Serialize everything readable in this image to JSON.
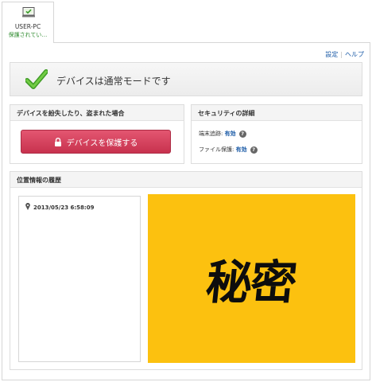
{
  "device": {
    "name": "USER-PC",
    "status": "保護されてい…",
    "icon": "computer-check-icon"
  },
  "toplinks": {
    "settings": "設定",
    "help": "ヘルプ"
  },
  "status": {
    "message": "デバイスは通常モードです",
    "icon": "green-check-icon"
  },
  "lost_card": {
    "title": "デバイスを紛失したり、盗まれた場合",
    "button_label": "デバイスを保護する"
  },
  "security_card": {
    "title": "セキュリティの詳細",
    "rows": [
      {
        "label": "端末追跡: ",
        "value": "有効"
      },
      {
        "label": "ファイル保護: ",
        "value": "有効"
      }
    ]
  },
  "location_card": {
    "title": "位置情報の履歴",
    "entries": [
      {
        "timestamp": "2013/05/23 6:58:09"
      }
    ],
    "map_text": "秘密"
  },
  "colors": {
    "accent_link": "#1a5aa6",
    "protect_button": "#d23f5c",
    "map_fill": "#fcc10f",
    "check_green": "#4caf2b"
  }
}
